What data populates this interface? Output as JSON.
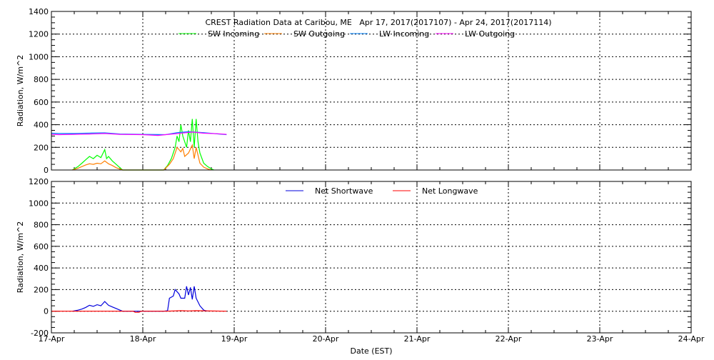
{
  "chart_data": [
    {
      "type": "line",
      "title": "CREST Radiation Data at Caribou, ME   Apr 17, 2017(2017107) - Apr 24, 2017(2017114)",
      "ylabel": "Radiation, W/m^2",
      "ylim": [
        0,
        1400
      ],
      "yticks": [
        "0",
        "200",
        "400",
        "600",
        "800",
        "1000",
        "1200",
        "1400"
      ],
      "xlim_hours": [
        0,
        168
      ],
      "grid": true,
      "legend_placement": "top",
      "series": [
        {
          "name": "SW Incoming",
          "color": "#00ff00",
          "x": [
            5.5,
            6,
            7,
            8,
            9,
            10,
            11,
            12,
            13,
            14,
            14.5,
            15,
            16,
            17,
            18,
            18.7,
            29.5,
            30.5,
            31.5,
            32.5,
            33,
            33.5,
            34,
            34.5,
            35,
            35.5,
            36,
            36.5,
            37,
            37.5,
            38,
            38.5,
            39,
            40,
            41,
            42,
            42.7
          ],
          "y": [
            0,
            10,
            30,
            60,
            90,
            120,
            100,
            130,
            110,
            180,
            100,
            120,
            80,
            50,
            20,
            0,
            0,
            40,
            100,
            200,
            300,
            250,
            400,
            300,
            250,
            200,
            350,
            250,
            450,
            200,
            450,
            250,
            150,
            60,
            30,
            10,
            0
          ]
        },
        {
          "name": "SW Outgoing",
          "color": "#ff7f00",
          "x": [
            5.5,
            6,
            7,
            8,
            9,
            10,
            11,
            12,
            13,
            14,
            15,
            16,
            17,
            18,
            18.7,
            29.5,
            31,
            32,
            33,
            34,
            34.5,
            35,
            36,
            37,
            37.5,
            38,
            39,
            40,
            41,
            42
          ],
          "y": [
            0,
            5,
            15,
            30,
            45,
            55,
            50,
            60,
            55,
            80,
            55,
            40,
            20,
            8,
            0,
            0,
            50,
            100,
            200,
            160,
            190,
            120,
            150,
            220,
            100,
            200,
            60,
            25,
            10,
            0
          ]
        },
        {
          "name": "LW Incoming",
          "color": "#0080ff",
          "x": [
            0,
            2,
            6,
            10,
            14,
            18,
            24,
            30,
            33,
            36,
            40,
            44,
            46
          ],
          "y": [
            325,
            322,
            322,
            326,
            328,
            318,
            315,
            312,
            330,
            338,
            330,
            318,
            312
          ]
        },
        {
          "name": "LW Outgoing",
          "color": "#ff00ff",
          "x": [
            0,
            2,
            10,
            14,
            18,
            24,
            28,
            30,
            34,
            37,
            40,
            44,
            46
          ],
          "y": [
            315,
            312,
            318,
            322,
            315,
            312,
            305,
            312,
            325,
            335,
            325,
            320,
            315
          ]
        }
      ]
    },
    {
      "type": "line",
      "title": "",
      "ylabel": "Radiation, W/m^2",
      "xlabel": "Date (EST)",
      "ylim": [
        -200,
        1200
      ],
      "yticks": [
        "-200",
        "0",
        "200",
        "400",
        "600",
        "800",
        "1000",
        "1200"
      ],
      "xlim_hours": [
        0,
        168
      ],
      "xticks": [
        "17-Apr",
        "18-Apr",
        "19-Apr",
        "20-Apr",
        "21-Apr",
        "22-Apr",
        "23-Apr",
        "24-Apr"
      ],
      "grid": true,
      "legend_placement": "top",
      "series": [
        {
          "name": "Net Shortwave",
          "color": "#0000dd",
          "x": [
            5.5,
            7,
            8,
            9,
            10,
            11,
            12,
            13,
            14,
            15,
            16,
            17,
            18,
            18.7,
            29.5,
            30.5,
            31,
            32,
            32.5,
            33.5,
            34,
            35,
            35.5,
            36,
            36.5,
            37,
            37.5,
            38,
            39,
            40,
            41
          ],
          "y": [
            0,
            10,
            20,
            35,
            55,
            45,
            60,
            50,
            90,
            55,
            40,
            25,
            10,
            0,
            0,
            5,
            120,
            140,
            200,
            160,
            120,
            120,
            230,
            150,
            220,
            110,
            230,
            120,
            50,
            10,
            0
          ]
        },
        {
          "name": "Net Longwave",
          "color": "#ff0000",
          "x": [
            0,
            21.5,
            22,
            23,
            23.5,
            30,
            34,
            36,
            38,
            46
          ],
          "y": [
            0,
            0,
            -10,
            -10,
            0,
            0,
            5,
            3,
            5,
            0
          ]
        }
      ]
    }
  ]
}
